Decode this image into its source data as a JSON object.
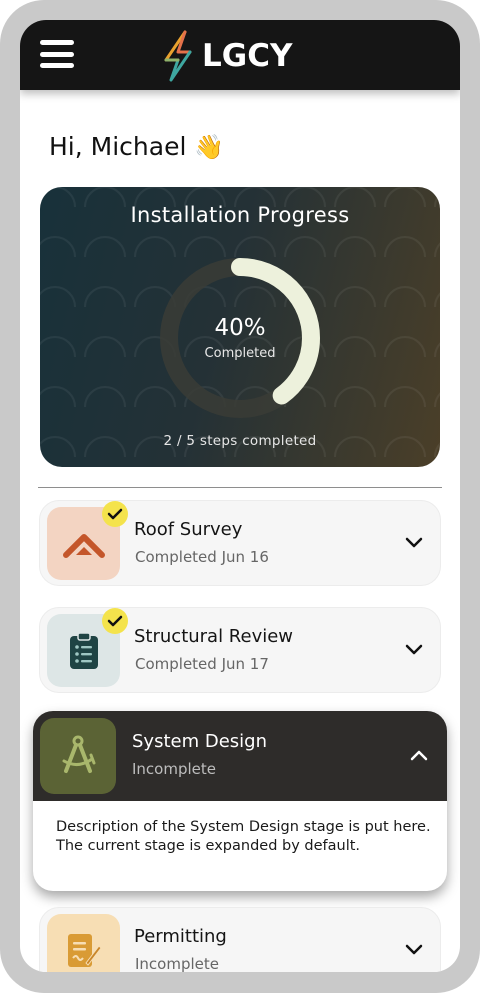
{
  "header": {
    "menu_icon": "hamburger-menu-icon",
    "logo_text": "LGCY"
  },
  "greeting": {
    "text": "Hi, Michael",
    "emoji": "👋"
  },
  "progress": {
    "title": "Installation Progress",
    "percent_label": "40%",
    "percent_value": 0.4,
    "completed_label": "Completed",
    "steps_label": "2 / 5 steps completed"
  },
  "stages": [
    {
      "title": "Roof Survey",
      "status": "Completed Jun 16",
      "completed": true,
      "icon": "roof-icon",
      "icon_bg": "#f3d4c2",
      "icon_color": "#c4562a",
      "expanded": false
    },
    {
      "title": "Structural Review",
      "status": "Completed Jun 17",
      "completed": true,
      "icon": "clipboard-checklist-icon",
      "icon_bg": "#dde6e6",
      "icon_color": "#1f4444",
      "expanded": false
    },
    {
      "title": "System Design",
      "status": "Incomplete",
      "completed": false,
      "icon": "drafting-compass-icon",
      "icon_bg": "#5b6335",
      "icon_color": "#a9b76c",
      "expanded": true,
      "description": "Description of the System Design stage is put here. The current stage is expanded by default."
    },
    {
      "title": "Permitting",
      "status": "Incomplete",
      "completed": false,
      "icon": "document-pen-icon",
      "icon_bg": "#f7deb4",
      "icon_color": "#d99b35",
      "expanded": false
    }
  ],
  "colors": {
    "check_badge": "#f4e34c",
    "header_bg": "#151515",
    "ring_track": "#3a3c36",
    "ring_fill": "#edf1dc"
  }
}
